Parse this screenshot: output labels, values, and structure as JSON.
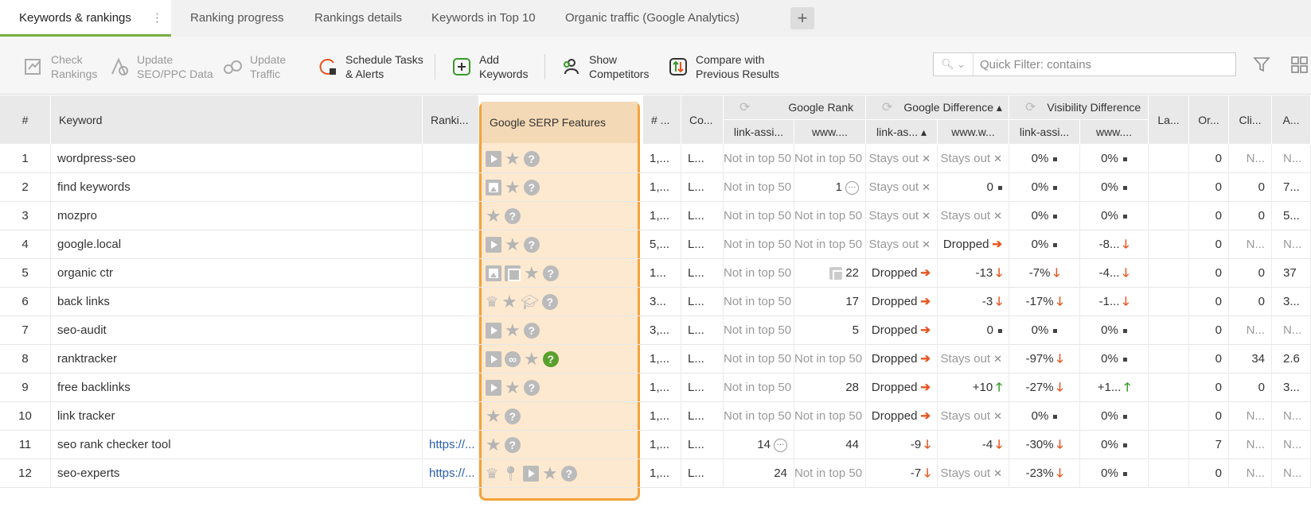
{
  "tabs": [
    {
      "label": "Keywords & rankings"
    },
    {
      "label": "Ranking progress"
    },
    {
      "label": "Rankings details"
    },
    {
      "label": "Keywords in Top 10"
    },
    {
      "label": "Organic traffic (Google Analytics)"
    }
  ],
  "toolbar": {
    "check": "Check\nRankings",
    "update_seo": "Update\nSEO/PPC Data",
    "update_traffic": "Update\nTraffic",
    "schedule": "Schedule Tasks\n& Alerts",
    "add": "Add\nKeywords",
    "competitors": "Show\nCompetitors",
    "compare": "Compare with\nPrevious Results",
    "search_placeholder": "Quick Filter: contains"
  },
  "headers": {
    "num": "#",
    "keyword": "Keyword",
    "ranking": "Ranki...",
    "serp": "Google SERP Features",
    "searches": "# ...",
    "comp": "Co...",
    "google_rank": "Google Rank",
    "google_diff": "Google Difference ▴",
    "vis_diff": "Visibility Difference",
    "sub_link": "link-assi...",
    "sub_www": "www....",
    "sub_link_diff": "link-as... ▴",
    "sub_www_diff": "www.w...",
    "sub_link_vis": "link-assi...",
    "sub_www_vis": "www....",
    "la": "La...",
    "or": "Or...",
    "cli": "Cli...",
    "a": "A..."
  },
  "rows": [
    {
      "n": "1",
      "kw": "wordpress-seo",
      "url": "",
      "serp": [
        "video",
        "star",
        "q"
      ],
      "s": "1,...",
      "c": "L...",
      "r1": "Not in top 50",
      "r2": "Not in top 50",
      "d1": "Stays out",
      "d1t": "x",
      "d2": "Stays out",
      "d2t": "x",
      "v1": "0%",
      "v1t": "dot",
      "v2": "0%",
      "v2t": "dot",
      "or": "0",
      "cli": "N...",
      "a": "N..."
    },
    {
      "n": "2",
      "kw": "find keywords",
      "url": "",
      "serp": [
        "image",
        "star",
        "q"
      ],
      "s": "1,...",
      "c": "L...",
      "r1": "Not in top 50",
      "r2": "1",
      "r2e": true,
      "d1": "Stays out",
      "d1t": "x",
      "d2": "0",
      "d2t": "dot",
      "v1": "0%",
      "v1t": "dot",
      "v2": "0%",
      "v2t": "dot",
      "or": "0",
      "cli": "0",
      "a": "7..."
    },
    {
      "n": "3",
      "kw": "mozpro",
      "url": "",
      "serp": [
        "star",
        "q"
      ],
      "s": "1,...",
      "c": "L...",
      "r1": "Not in top 50",
      "r2": "Not in top 50",
      "d1": "Stays out",
      "d1t": "x",
      "d2": "Stays out",
      "d2t": "x",
      "v1": "0%",
      "v1t": "dot",
      "v2": "0%",
      "v2t": "dot",
      "or": "0",
      "cli": "0",
      "a": "5..."
    },
    {
      "n": "4",
      "kw": "google.local",
      "url": "",
      "serp": [
        "video",
        "star",
        "q"
      ],
      "s": "5,...",
      "c": "L...",
      "r1": "Not in top 50",
      "r2": "Not in top 50",
      "d1": "Stays out",
      "d1t": "x",
      "d2": "Dropped",
      "d2t": "right",
      "v1": "0%",
      "v1t": "dot",
      "v2": "-8...",
      "v2t": "down",
      "or": "0",
      "cli": "N...",
      "a": "N..."
    },
    {
      "n": "5",
      "kw": "organic ctr",
      "url": "",
      "serp": [
        "image",
        "fs",
        "star",
        "q"
      ],
      "s": "1...",
      "c": "L...",
      "r1": "Not in top 50",
      "r2": "22",
      "r2t": true,
      "d1": "Dropped",
      "d1t": "right",
      "d2": "-13",
      "d2t": "down",
      "v1": "-7%",
      "v1t": "down",
      "v2": "-4...",
      "v2t": "down",
      "or": "0",
      "cli": "0",
      "a": "37"
    },
    {
      "n": "6",
      "kw": "back links",
      "url": "",
      "serp": [
        "crown",
        "star",
        "cap",
        "q"
      ],
      "s": "3...",
      "c": "L...",
      "r1": "Not in top 50",
      "r2": "17",
      "d1": "Dropped",
      "d1t": "right",
      "d2": "-3",
      "d2t": "down",
      "v1": "-17%",
      "v1t": "down",
      "v2": "-1...",
      "v2t": "down",
      "or": "0",
      "cli": "0",
      "a": "3..."
    },
    {
      "n": "7",
      "kw": "seo-audit",
      "url": "",
      "serp": [
        "video",
        "star",
        "q"
      ],
      "s": "3,...",
      "c": "L...",
      "r1": "Not in top 50",
      "r2": "5",
      "d1": "Dropped",
      "d1t": "right",
      "d2": "0",
      "d2t": "dot",
      "v1": "0%",
      "v1t": "dot",
      "v2": "0%",
      "v2t": "dot",
      "or": "0",
      "cli": "N...",
      "a": "N..."
    },
    {
      "n": "8",
      "kw": "ranktracker",
      "url": "",
      "serp": [
        "video",
        "link",
        "star",
        "qg"
      ],
      "s": "1,...",
      "c": "L...",
      "r1": "Not in top 50",
      "r2": "Not in top 50",
      "d1": "Dropped",
      "d1t": "right",
      "d2": "Stays out",
      "d2t": "x",
      "v1": "-97%",
      "v1t": "down",
      "v2": "0%",
      "v2t": "dot",
      "or": "0",
      "cli": "34",
      "a": "2.6"
    },
    {
      "n": "9",
      "kw": "free backlinks",
      "url": "",
      "serp": [
        "video",
        "star",
        "q"
      ],
      "s": "1,...",
      "c": "L...",
      "r1": "Not in top 50",
      "r2": "28",
      "d1": "Dropped",
      "d1t": "right",
      "d2": "+10",
      "d2t": "up",
      "v1": "-27%",
      "v1t": "down",
      "v2": "+1...",
      "v2t": "up",
      "or": "0",
      "cli": "0",
      "a": "3..."
    },
    {
      "n": "10",
      "kw": "link tracker",
      "url": "",
      "serp": [
        "star",
        "q"
      ],
      "s": "1,...",
      "c": "L...",
      "r1": "Not in top 50",
      "r2": "Not in top 50",
      "d1": "Dropped",
      "d1t": "right",
      "d2": "Stays out",
      "d2t": "x",
      "v1": "0%",
      "v1t": "dot",
      "v2": "0%",
      "v2t": "dot",
      "or": "0",
      "cli": "N...",
      "a": "N..."
    },
    {
      "n": "11",
      "kw": "seo rank checker tool",
      "url": "https://...",
      "serp": [
        "star",
        "q"
      ],
      "s": "1,...",
      "c": "L...",
      "r1": "14",
      "r1e": true,
      "r2": "44",
      "d1": "-9",
      "d1t": "down",
      "d2": "-4",
      "d2t": "down",
      "v1": "-30%",
      "v1t": "down",
      "v2": "0%",
      "v2t": "dot",
      "or": "7",
      "cli": "N...",
      "a": "N..."
    },
    {
      "n": "12",
      "kw": "seo-experts",
      "url": "https://...",
      "serp": [
        "crown",
        "pin",
        "video",
        "star",
        "q"
      ],
      "s": "1,...",
      "c": "L...",
      "r1": "24",
      "r2": "Not in top 50",
      "d1": "-7",
      "d1t": "down",
      "d2": "Stays out",
      "d2t": "x",
      "v1": "-23%",
      "v1t": "down",
      "v2": "0%",
      "v2t": "dot",
      "or": "0",
      "cli": "N...",
      "a": "N..."
    }
  ]
}
